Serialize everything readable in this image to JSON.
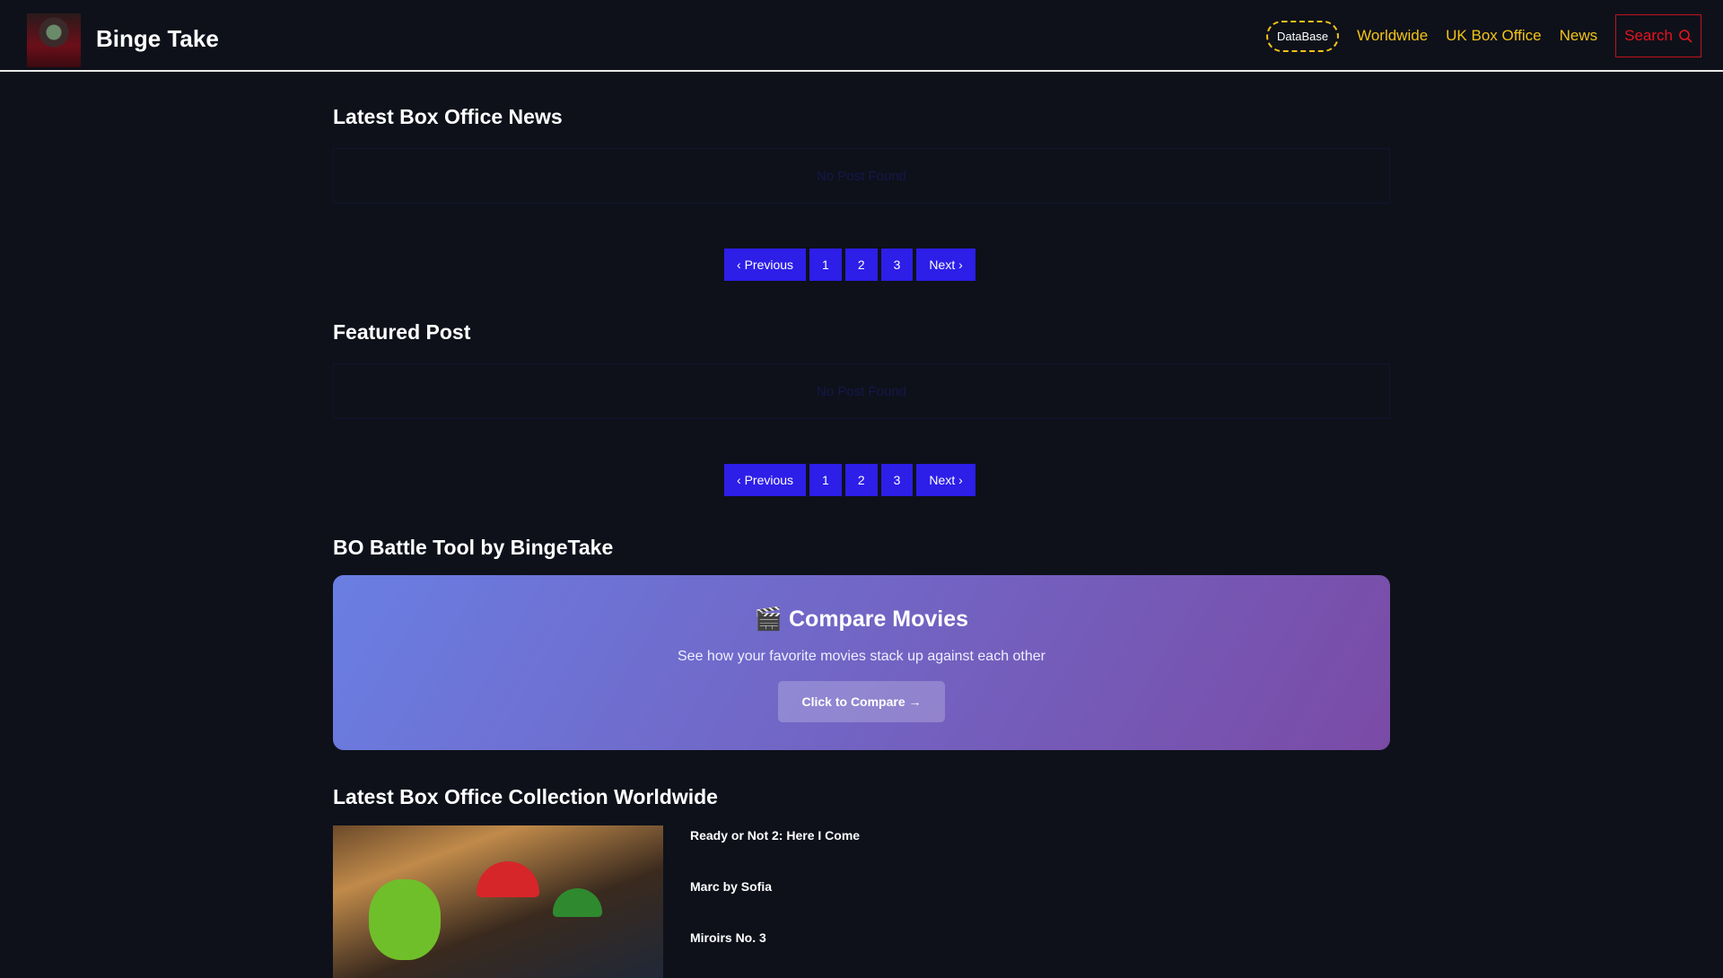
{
  "header": {
    "brand": "Binge Take",
    "nav": {
      "database": "DataBase",
      "worldwide": "Worldwide",
      "uk": "UK Box Office",
      "news": "News",
      "search": "Search"
    }
  },
  "sections": {
    "news": {
      "title": "Latest Box Office News",
      "empty": "No Post Found"
    },
    "featured": {
      "title": "Featured Post",
      "empty": "No Post Found"
    },
    "battle": {
      "title": "BO Battle Tool by BingeTake",
      "card_title": "🎬 Compare Movies",
      "card_subtitle": "See how your favorite movies stack up against each other",
      "card_button": "Click to Compare →"
    },
    "worldwide": {
      "title": "Latest Box Office Collection Worldwide",
      "items": [
        "Ready or Not 2: Here I Come",
        "Marc by Sofia",
        "Miroirs No. 3"
      ]
    }
  },
  "pagination": {
    "prev": "Previous",
    "pages": [
      "1",
      "2",
      "3"
    ],
    "next": "Next"
  }
}
